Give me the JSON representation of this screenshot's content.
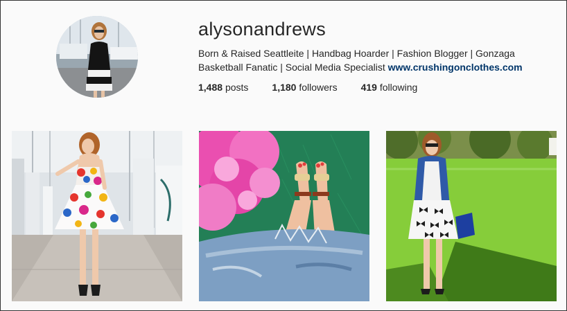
{
  "profile": {
    "username": "alysonandrews",
    "bio_text": "Born & Raised Seattleite | Handbag Hoarder | Fashion Blogger | Gonzaga Basketball Fanatic | Social Media Specialist ",
    "website": "www.crushingonclothes.com"
  },
  "stats": {
    "posts_count": "1,488",
    "posts_label": "posts",
    "followers_count": "1,180",
    "followers_label": "followers",
    "following_count": "419",
    "following_label": "following"
  },
  "colors": {
    "link": "#003569",
    "text": "#262626",
    "background": "#fafafa"
  },
  "photos": [
    {
      "description_icon": "photo-woman-polka-dot-dress-marina"
    },
    {
      "description_icon": "photo-pink-peonies-sandals-denim"
    },
    {
      "description_icon": "photo-woman-bow-dress-park"
    }
  ]
}
